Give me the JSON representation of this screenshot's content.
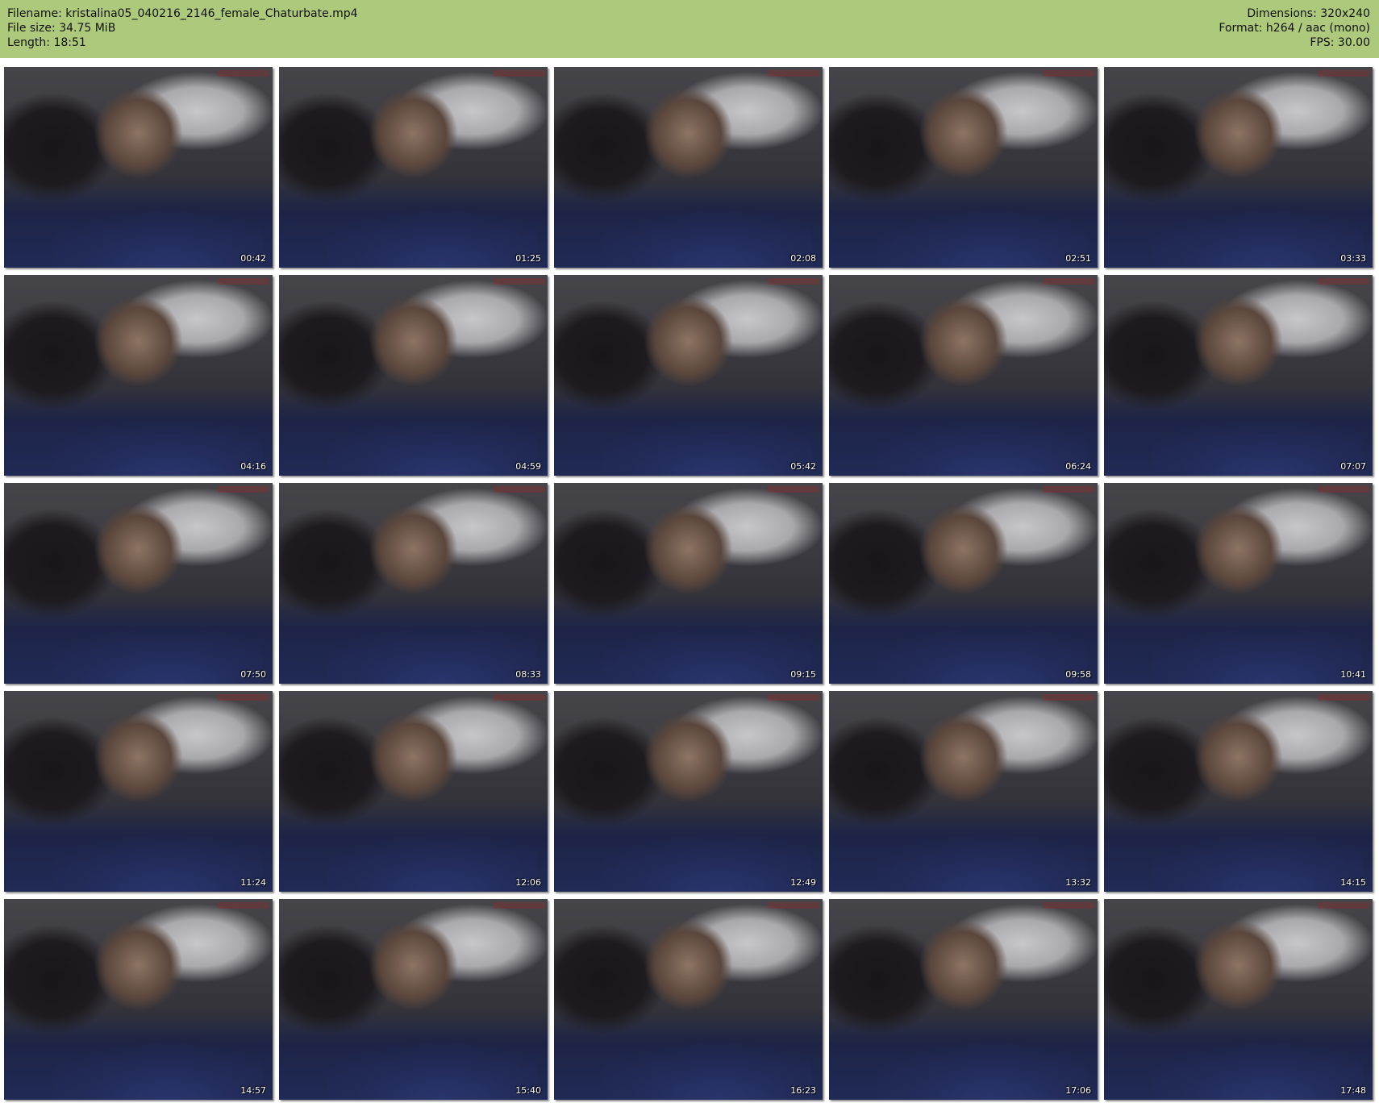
{
  "meta": {
    "filename": "Filename: kristalina05_040216_2146_female_Chaturbate.mp4",
    "filesize": "File size: 34.75 MiB",
    "length": "Length: 18:51",
    "dimensions": "Dimensions: 320x240",
    "format": "Format: h264 / aac (mono)",
    "fps": "FPS: 30.00"
  },
  "colors": {
    "header_background": "#adc97b",
    "page_background": "#ffffff"
  },
  "thumbnails": [
    "00:42",
    "01:25",
    "02:08",
    "02:51",
    "03:33",
    "04:16",
    "04:59",
    "05:42",
    "06:24",
    "07:07",
    "07:50",
    "08:33",
    "09:15",
    "09:58",
    "10:41",
    "11:24",
    "12:06",
    "12:49",
    "13:32",
    "14:15",
    "14:57",
    "15:40",
    "16:23",
    "17:06",
    "17:48"
  ]
}
